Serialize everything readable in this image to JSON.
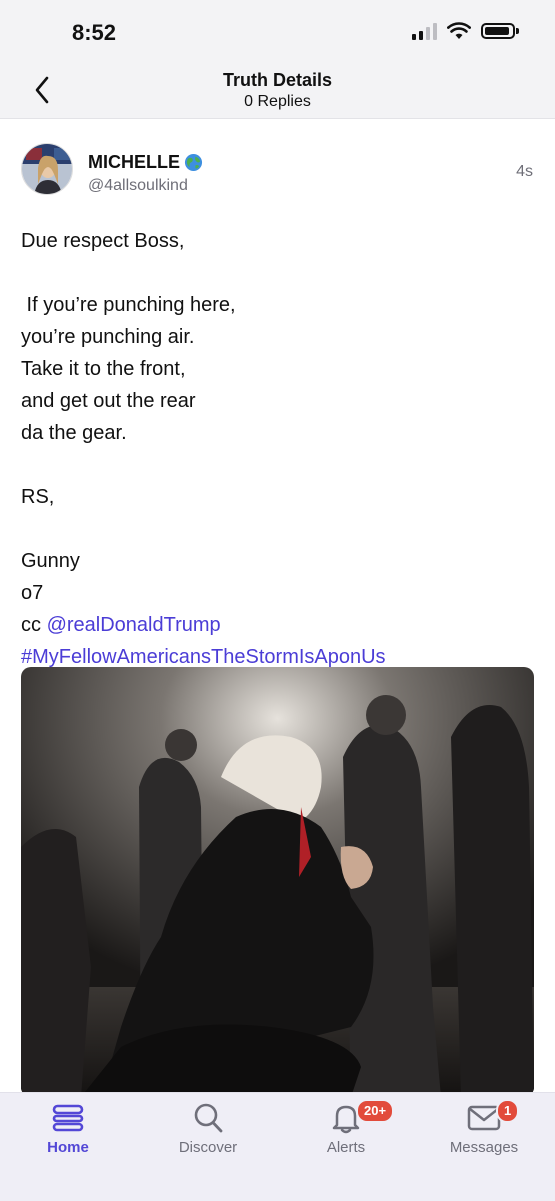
{
  "status_bar": {
    "time": "8:52"
  },
  "header": {
    "title": "Truth Details",
    "subtitle": "0 Replies"
  },
  "post": {
    "author_name": "MICHELLE",
    "handle": "@4allsoulkind",
    "timestamp": "4s",
    "lines": [
      "Due respect Boss,",
      "",
      " If you’re punching here,",
      "you’re punching air.",
      "Take it to the front,",
      "and get out the rear",
      "da the gear.",
      "",
      "RS,",
      "",
      "Gunny",
      "o7"
    ],
    "cc_prefix": "cc ",
    "mention": "@realDonaldTrump",
    "hashtag": "#MyFellowAmericansTheStormIsAponUs"
  },
  "tab_bar": {
    "tabs": [
      {
        "label": "Home",
        "icon": "home-icon",
        "active": true
      },
      {
        "label": "Discover",
        "icon": "search-icon",
        "active": false
      },
      {
        "label": "Alerts",
        "icon": "bell-icon",
        "active": false,
        "badge": "20+"
      },
      {
        "label": "Messages",
        "icon": "envelope-icon",
        "active": false,
        "badge": "1"
      }
    ]
  },
  "colors": {
    "accent": "#5347d6",
    "link": "#4b3dd6",
    "badge": "#e24b3b"
  }
}
